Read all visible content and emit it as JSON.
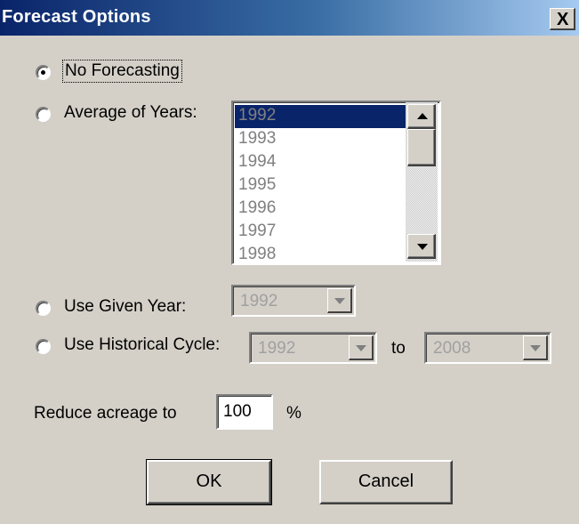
{
  "window": {
    "title": "Forecast Options",
    "close_glyph": "X"
  },
  "options": {
    "no_forecasting": {
      "label": "No Forecasting",
      "selected": true
    },
    "average_of_years": {
      "label": "Average of Years:",
      "selected": false,
      "years": [
        "1992",
        "1993",
        "1994",
        "1995",
        "1996",
        "1997",
        "1998"
      ],
      "selected_year": "1992"
    },
    "use_given_year": {
      "label": "Use Given Year:",
      "selected": false,
      "value": "1992"
    },
    "use_historical_cycle": {
      "label": "Use Historical Cycle:",
      "selected": false,
      "from_value": "1992",
      "to_label": "to",
      "to_value": "2008"
    }
  },
  "reduce_acreage": {
    "label": "Reduce acreage to",
    "value": "100",
    "unit": "%"
  },
  "buttons": {
    "ok": "OK",
    "cancel": "Cancel"
  },
  "icons": {
    "scroll_up": "triangle-up-icon",
    "scroll_down": "triangle-down-icon",
    "dropdown": "triangle-down-icon"
  },
  "colors": {
    "title_gradient_start": "#0a246a",
    "title_gradient_end": "#a6caf0",
    "dialog_background": "#d4d0c8",
    "selection": "#0a246a",
    "disabled_text": "#a0a0a0"
  }
}
